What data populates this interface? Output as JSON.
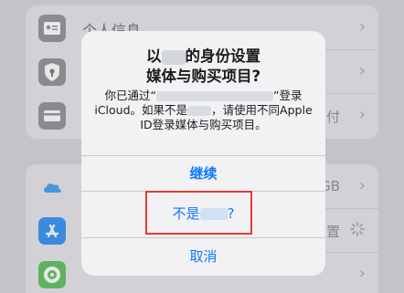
{
  "background": {
    "group1": [
      {
        "label": "个人信息",
        "value": "",
        "icon": "contact-card-icon"
      },
      {
        "label": "",
        "value": "",
        "icon": "lock-shield-icon"
      },
      {
        "label": "",
        "value": "支付",
        "icon": "credit-card-icon"
      }
    ],
    "group2": [
      {
        "label": "",
        "value": "GB",
        "icon": "icloud-icon"
      },
      {
        "label": "",
        "value": "置",
        "icon": "app-store-icon"
      },
      {
        "label": "",
        "value": "",
        "icon": "find-my-icon"
      }
    ]
  },
  "alert": {
    "title_prefix": "以",
    "title_suffix": "的身份设置",
    "title_line2": "媒体与购买项目?",
    "msg_prefix": "你已通过“",
    "msg_mid": "”登录iCloud。如果不是",
    "msg_suffix": "，请使用不同Apple ID登录媒体与购买项目。",
    "continue_label": "继续",
    "not_prefix": "不是",
    "not_suffix": "?",
    "cancel_label": "取消"
  },
  "colors": {
    "accent": "#0a7aff",
    "highlight": "#e53935"
  }
}
